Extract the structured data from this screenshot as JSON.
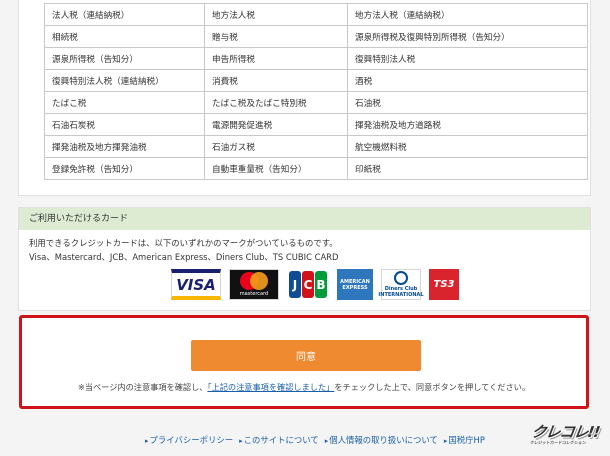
{
  "tax_table": {
    "rows": [
      [
        "法人税（連結納税）",
        "地方法人税",
        "地方法人税（連結納税）"
      ],
      [
        "相続税",
        "贈与税",
        "源泉所得税及復興特別所得税（告知分）"
      ],
      [
        "源泉所得税（告知分）",
        "申告所得税",
        "復興特別法人税"
      ],
      [
        "復興特別法人税（連結納税）",
        "消費税",
        "酒税"
      ],
      [
        "たばこ税",
        "たばこ税及たばこ特別税",
        "石油税"
      ],
      [
        "石油石炭税",
        "電源開発促進税",
        "揮発油税及地方道路税"
      ],
      [
        "揮発油税及地方揮発油税",
        "石油ガス税",
        "航空機燃料税"
      ],
      [
        "登録免許税（告知分）",
        "自動車重量税（告知分）",
        "印紙税"
      ]
    ]
  },
  "card_section": {
    "heading": "ご利用いただけるカード",
    "description": "利用できるクレジットカードは、以下のいずれかのマークがついているものです。",
    "brands_text": "Visa、Mastercard、JCB、American Express、Diners Club、TS CUBIC CARD",
    "logos": {
      "visa": "VISA",
      "mastercard": "mastercard",
      "jcb": [
        "J",
        "C",
        "B"
      ],
      "amex": [
        "AMERICAN",
        "EXPRESS"
      ],
      "diners": [
        "Diners Club",
        "INTERNATIONAL"
      ],
      "ts3": "TS3"
    }
  },
  "agree": {
    "button_label": "同意",
    "note_prefix": "※当ページ内の注意事項を確認し、",
    "note_link": "「上記の注意事項を確認しました」",
    "note_suffix": "をチェックした上で、同意ボタンを押してください。"
  },
  "footer": {
    "links": [
      "プライバシーポリシー",
      "このサイトについて",
      "個人情報の取り扱いについて",
      "国税庁HP"
    ]
  },
  "brand": {
    "name": "クレコレ!!",
    "tagline": "クレジットカードコレクション"
  },
  "colors": {
    "accent_button": "#f08a30",
    "highlight_border": "#d0121b",
    "section_head_bg": "#dcebd2",
    "link": "#1a5fa8"
  }
}
